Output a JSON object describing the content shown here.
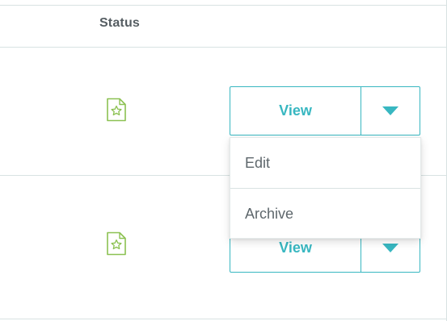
{
  "table": {
    "status_header": "Status",
    "rows": [
      {
        "status_icon": "starred-document-icon",
        "view_label": "View"
      },
      {
        "status_icon": "starred-document-icon",
        "view_label": "View"
      }
    ]
  },
  "dropdown_menu": {
    "items": [
      {
        "label": "Edit"
      },
      {
        "label": "Archive"
      }
    ]
  },
  "colors": {
    "accent": "#38b7c1",
    "icon_green": "#8cc152",
    "border": "#d8e2e2",
    "header_text": "#555d62",
    "menu_text": "#5e676c"
  }
}
